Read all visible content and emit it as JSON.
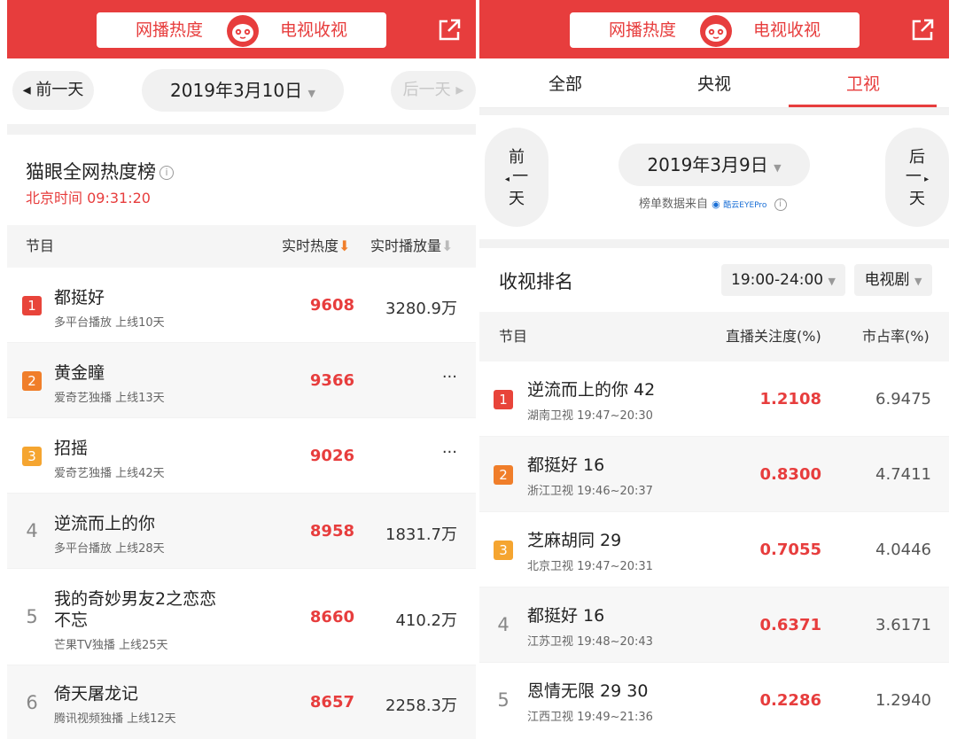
{
  "left": {
    "header": {
      "tab_web": "网播热度",
      "tab_tv": "电视收视",
      "active_tab": "网播热度"
    },
    "datebar": {
      "prev": "◂ 前一天",
      "date": "2019年3月10日",
      "next": "后一天 ▸"
    },
    "section": {
      "title": "猫眼全网热度榜",
      "time": "北京时间 09:31:20"
    },
    "table_headers": {
      "program": "节目",
      "heat": "实时热度",
      "plays": "实时播放量"
    },
    "rows": [
      {
        "rank": "1",
        "name": "都挺好",
        "sub": "多平台播放 上线10天",
        "heat": "9608",
        "plays": "3280.9万"
      },
      {
        "rank": "2",
        "name": "黄金瞳",
        "sub": "爱奇艺独播 上线13天",
        "heat": "9366",
        "plays": "···"
      },
      {
        "rank": "3",
        "name": "招摇",
        "sub": "爱奇艺独播 上线42天",
        "heat": "9026",
        "plays": "···"
      },
      {
        "rank": "4",
        "name": "逆流而上的你",
        "sub": "多平台播放 上线28天",
        "heat": "8958",
        "plays": "1831.7万"
      },
      {
        "rank": "5",
        "name_line1": "我的奇妙男友2之恋恋",
        "name_line2": "不忘",
        "sub": "芒果TV独播 上线25天",
        "heat": "8660",
        "plays": "410.2万"
      },
      {
        "rank": "6",
        "name": "倚天屠龙记",
        "sub": "腾讯视频独播 上线12天",
        "heat": "8657",
        "plays": "2258.3万"
      }
    ],
    "colors": {
      "rank1": "#e8443a",
      "rank2": "#f07e2a",
      "rank3": "#f5a530",
      "brand": "#e73d3d"
    }
  },
  "right": {
    "header": {
      "tab_web": "网播热度",
      "tab_tv": "电视收视",
      "active_tab": "电视收视"
    },
    "tabs": {
      "all": "全部",
      "cctv": "央视",
      "satellite": "卫视",
      "active": "卫视"
    },
    "datebar": {
      "prev_1": "前",
      "prev_2": "一",
      "prev_3": "天",
      "date": "2019年3月9日",
      "next_1": "后",
      "next_2": "一",
      "next_3": "天",
      "source_text": "榜单数据来自",
      "source_brand": "酷云EYEPro"
    },
    "section": {
      "title": "收视排名",
      "time_slot": "19:00-24:00",
      "genre": "电视剧"
    },
    "table_headers": {
      "program": "节目",
      "attention": "直播关注度(%)",
      "share": "市占率(%)"
    },
    "rows": [
      {
        "rank": "1",
        "name": "逆流而上的你 42",
        "sub": "湖南卫视 19:47~20:30",
        "attention": "1.2108",
        "share": "6.9475"
      },
      {
        "rank": "2",
        "name": "都挺好 16",
        "sub": "浙江卫视 19:46~20:37",
        "attention": "0.8300",
        "share": "4.7411"
      },
      {
        "rank": "3",
        "name": "芝麻胡同 29",
        "sub": "北京卫视 19:47~20:31",
        "attention": "0.7055",
        "share": "4.0446"
      },
      {
        "rank": "4",
        "name": "都挺好 16",
        "sub": "江苏卫视 19:48~20:43",
        "attention": "0.6371",
        "share": "3.6171"
      },
      {
        "rank": "5",
        "name": "恩情无限 29 30",
        "sub": "江西卫视 19:49~21:36",
        "attention": "0.2286",
        "share": "1.2940"
      }
    ]
  }
}
